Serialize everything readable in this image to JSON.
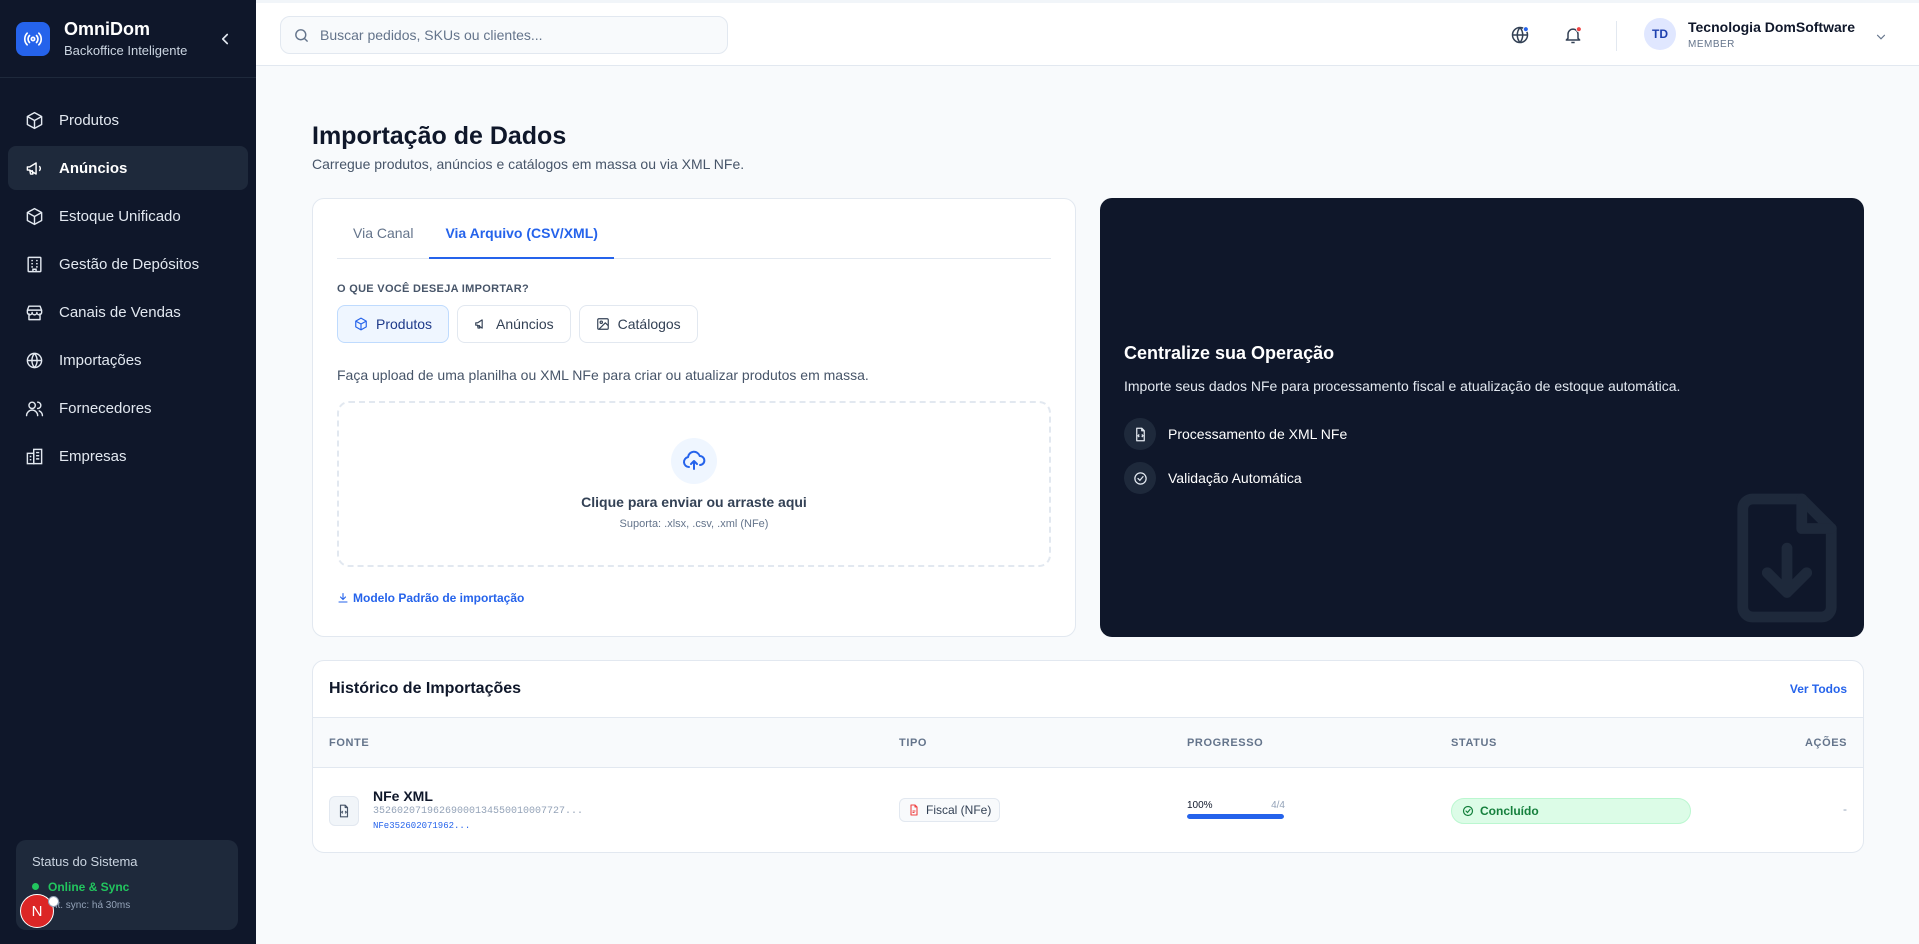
{
  "brand": {
    "name": "OmniDom",
    "subtitle": "Backoffice Inteligente",
    "icon": "broadcast-icon",
    "accent": "#2563eb"
  },
  "sidebar": {
    "items": [
      {
        "label": "Produtos",
        "icon": "box-icon",
        "active": false
      },
      {
        "label": "Anúncios",
        "icon": "megaphone-icon",
        "active": true
      },
      {
        "label": "Estoque Unificado",
        "icon": "box-icon",
        "active": false
      },
      {
        "label": "Gestão de Depósitos",
        "icon": "building-icon",
        "active": false
      },
      {
        "label": "Canais de Vendas",
        "icon": "store-icon",
        "active": false
      },
      {
        "label": "Importações",
        "icon": "globe-icon",
        "active": false
      },
      {
        "label": "Fornecedores",
        "icon": "users-icon",
        "active": false
      },
      {
        "label": "Empresas",
        "icon": "building-icon",
        "active": false
      }
    ],
    "status": {
      "title": "Status do Sistema",
      "state": "Online & Sync",
      "last_sync": "Últ. sync: há 30ms"
    },
    "floating_avatar": "N"
  },
  "header": {
    "search_placeholder": "Buscar pedidos, SKUs ou clientes...",
    "user": {
      "initials": "TD",
      "name": "Tecnologia DomSoftware",
      "role": "MEMBER"
    }
  },
  "page": {
    "title": "Importação de Dados",
    "subtitle": "Carregue produtos, anúncios e catálogos em massa ou via XML NFe."
  },
  "import_card": {
    "tabs": [
      {
        "label": "Via Canal",
        "active": false
      },
      {
        "label": "Via Arquivo (CSV/XML)",
        "active": true
      }
    ],
    "question": "O QUE VOCÊ DESEJA IMPORTAR?",
    "types": [
      {
        "label": "Produtos",
        "icon": "box-icon",
        "active": true
      },
      {
        "label": "Anúncios",
        "icon": "megaphone-icon",
        "active": false
      },
      {
        "label": "Catálogos",
        "icon": "image-icon",
        "active": false
      }
    ],
    "description": "Faça upload de uma planilha ou XML NFe para criar ou atualizar produtos em massa.",
    "dropzone": {
      "title": "Clique para enviar ou arraste aqui",
      "formats": "Suporta: .xlsx, .csv, .xml (NFe)"
    },
    "template_link": "Modelo Padrão de importação"
  },
  "promo": {
    "title": "Centralize sua Operação",
    "description": "Importe seus dados NFe para processamento fiscal e atualização de estoque automática.",
    "features": [
      {
        "label": "Processamento de XML NFe",
        "icon": "file-code-icon"
      },
      {
        "label": "Validação Automática",
        "icon": "check-circle-icon"
      }
    ]
  },
  "history": {
    "title": "Histórico de Importações",
    "view_all": "Ver Todos",
    "columns": {
      "source": "FONTE",
      "type": "TIPO",
      "progress": "PROGRESSO",
      "status": "STATUS",
      "actions": "AÇÕES"
    },
    "rows": [
      {
        "source_name": "NFe XML",
        "source_key": "35260207196269000134550010007727...",
        "source_file": "NFe352602071962...",
        "type": "Fiscal (NFe)",
        "progress_label": "100%",
        "progress_value": 100,
        "progress_count": "4/4",
        "status": "Concluído",
        "status_color": "#15803d",
        "actions": "-"
      }
    ]
  }
}
